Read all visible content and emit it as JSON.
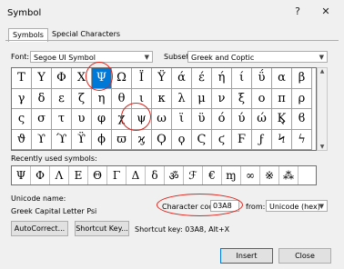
{
  "window": {
    "title": "Symbol",
    "help_label": "?",
    "close_label": "✕"
  },
  "tabs": [
    {
      "label": "Symbols",
      "active": true
    },
    {
      "label": "Special Characters",
      "active": false
    }
  ],
  "font": {
    "label": "Font:",
    "value": "Segoe UI Symbol"
  },
  "subset": {
    "label": "Subset:",
    "value": "Greek and Coptic"
  },
  "symbols": [
    [
      "Τ",
      "Υ",
      "Φ",
      "Χ",
      "Ψ",
      "Ω",
      "Ϊ",
      "Ϋ",
      "ά",
      "έ",
      "ή",
      "ί",
      "ΰ",
      "α",
      "β"
    ],
    [
      "γ",
      "δ",
      "ε",
      "ζ",
      "η",
      "θ",
      "ι",
      "κ",
      "λ",
      "μ",
      "ν",
      "ξ",
      "ο",
      "π",
      "ρ"
    ],
    [
      "ς",
      "σ",
      "τ",
      "υ",
      "φ",
      "χ",
      "ψ",
      "ω",
      "ϊ",
      "ϋ",
      "ό",
      "ύ",
      "ώ",
      "Ϗ",
      "ϐ"
    ],
    [
      "ϑ",
      "ϒ",
      "ϓ",
      "ϔ",
      "ϕ",
      "ϖ",
      "ϗ",
      "Ϙ",
      "ϙ",
      "Ϛ",
      "ϛ",
      "Ϝ",
      "ϝ",
      "Ϟ",
      "ϟ"
    ]
  ],
  "selected_symbol": "Ψ",
  "recent": {
    "label": "Recently used symbols:",
    "items": [
      "Ψ",
      "Φ",
      "Λ",
      "Ε",
      "Θ",
      "Γ",
      "Δ",
      "δ",
      "ॐ",
      "ℱ",
      "€",
      "ɱ",
      "∞",
      "※",
      "⁂"
    ]
  },
  "unicode_name": {
    "label": "Unicode name:",
    "value": "Greek Capital Letter Psi"
  },
  "character_code": {
    "label": "Character code:",
    "value": "03A8"
  },
  "from": {
    "label": "from:",
    "value": "Unicode (hex)"
  },
  "buttons": {
    "autocorrect": "AutoCorrect...",
    "shortcut_key": "Shortcut Key...",
    "insert": "Insert",
    "close": "Close"
  },
  "shortcut_text": "Shortcut key: 03A8, Alt+X",
  "colors": {
    "selection": "#0078d7",
    "annotation": "#e0231b"
  }
}
